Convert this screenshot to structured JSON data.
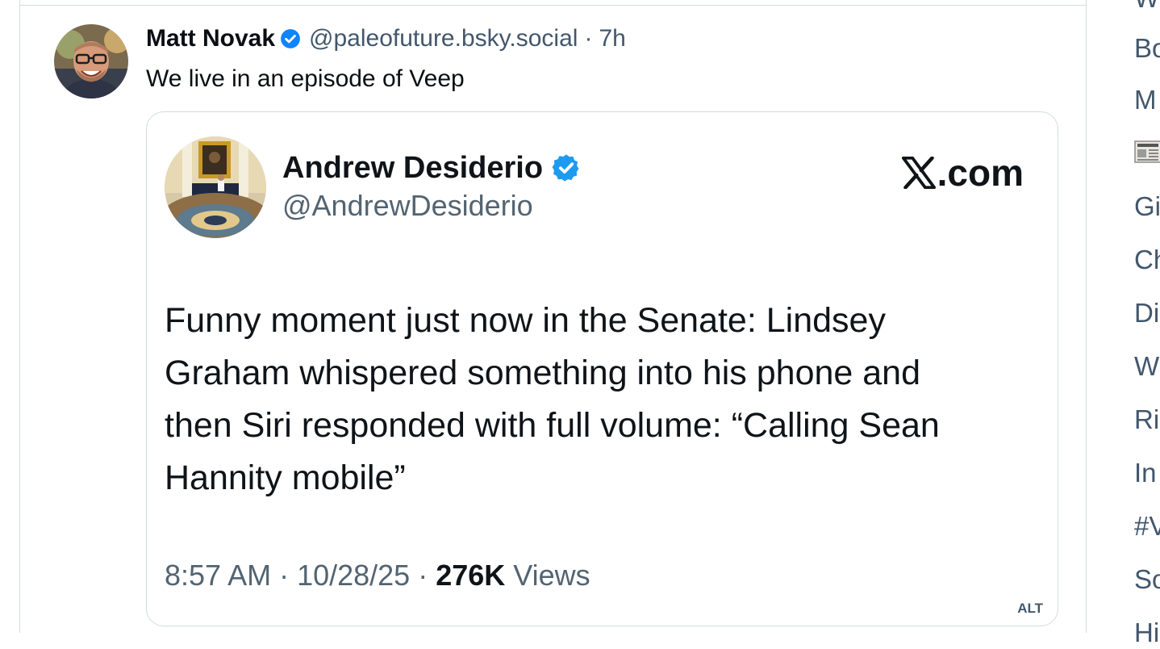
{
  "post": {
    "author_name": "Matt Novak",
    "author_handle": "@paleofuture.bsky.social",
    "separator": "·",
    "time": "7h",
    "text": "We live in an episode of Veep",
    "alt_badge": "ALT"
  },
  "embed": {
    "name": "Andrew Desiderio",
    "handle": "@AndrewDesiderio",
    "brand": ".com",
    "body_lines": [
      "Funny moment just now in the Senate: Lindsey",
      "Graham whispered something into his phone and",
      "then Siri responded with full volume: “Calling Sean",
      "Hannity mobile”"
    ],
    "timestamp": "8:57 AM · 10/28/25 · ",
    "views_count": "276K",
    "views_label": " Views"
  },
  "sidebar": {
    "trends": [
      "W",
      "Bo",
      "M",
      "Gi",
      "Ch",
      "Di",
      "W",
      "Ri",
      "In",
      "#V",
      "So",
      "Hi"
    ]
  },
  "colors": {
    "verified_blue": "#1083fe",
    "x_verified_blue": "#1d9bf0",
    "muted_text": "#42576c",
    "border": "#d4dbe2"
  },
  "icons": {
    "verified": "verified-check-icon",
    "x_logo": "x-logo-icon",
    "news_emoji": "newspaper-icon"
  }
}
